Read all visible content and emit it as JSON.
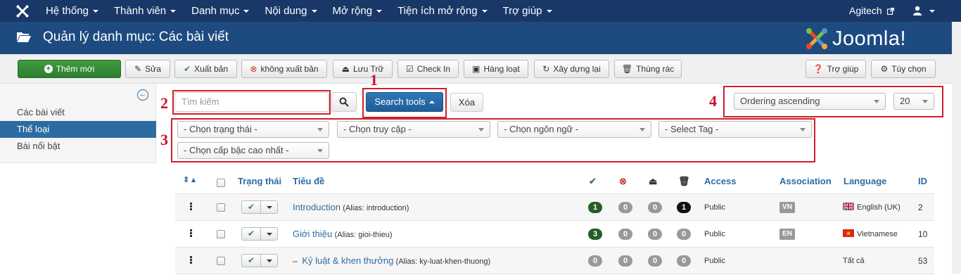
{
  "topnav": {
    "menu": [
      {
        "label": "Hệ thống"
      },
      {
        "label": "Thành viên"
      },
      {
        "label": "Danh mục"
      },
      {
        "label": "Nội dung"
      },
      {
        "label": "Mở rộng"
      },
      {
        "label": "Tiện ích mở rộng"
      },
      {
        "label": "Trợ giúp"
      }
    ],
    "user_label": "Agitech"
  },
  "titlebar": {
    "title": "Quản lý danh mục: Các bài viết",
    "brand": "Joomla!"
  },
  "toolbar": {
    "new": "Thêm mới",
    "edit": "Sửa",
    "publish": "Xuất bản",
    "unpublish": "không xuất bản",
    "archive": "Lưu Trữ",
    "checkin": "Check In",
    "batch": "Hàng loạt",
    "rebuild": "Xây dựng lại",
    "trash": "Thùng rác",
    "help": "Trợ giúp",
    "options": "Tùy chọn"
  },
  "sidebar": {
    "items": [
      {
        "label": "Các bài viết",
        "active": false
      },
      {
        "label": "Thể loại",
        "active": true
      },
      {
        "label": "Bài nổi bật",
        "active": false
      }
    ]
  },
  "filters": {
    "search_placeholder": "Tìm kiếm",
    "search_tools": "Search tools",
    "clear": "Xóa",
    "ordering": "Ordering ascending",
    "limit": "20",
    "status": "- Chọn trạng thái -",
    "access": "- Chọn truy cập -",
    "language": "- Chọn ngôn ngữ -",
    "tag": "- Select Tag -",
    "max_level": "- Chọn cấp bậc cao nhất -"
  },
  "annotations": [
    "1",
    "2",
    "3",
    "4"
  ],
  "table": {
    "headers": {
      "status": "Trạng thái",
      "title": "Tiêu đề",
      "access": "Access",
      "association": "Association",
      "language": "Language",
      "id": "ID"
    },
    "rows": [
      {
        "title": "Introduction",
        "alias": "(Alias: introduction)",
        "prefix": "",
        "published": "1",
        "unpublished": "0",
        "archived": "0",
        "trashed": "1",
        "access": "Public",
        "association": "VN",
        "language": "English (UK)",
        "id": "2"
      },
      {
        "title": "Giới thiệu",
        "alias": "(Alias: gioi-thieu)",
        "prefix": "",
        "published": "3",
        "unpublished": "0",
        "archived": "0",
        "trashed": "0",
        "access": "Public",
        "association": "EN",
        "language": "Vietnamese",
        "id": "10"
      },
      {
        "title": "Kỷ luật & khen thưởng",
        "alias": "(Alias: ky-luat-khen-thuong)",
        "prefix": "–",
        "published": "0",
        "unpublished": "0",
        "archived": "0",
        "trashed": "0",
        "access": "Public",
        "association": "",
        "language": "Tất cả",
        "id": "53"
      }
    ]
  },
  "colors": {
    "nav": "#1a3867",
    "title": "#1d4b80",
    "primary": "#2d6ca2",
    "success": "#2f7d32",
    "annotation": "#d0202b"
  }
}
